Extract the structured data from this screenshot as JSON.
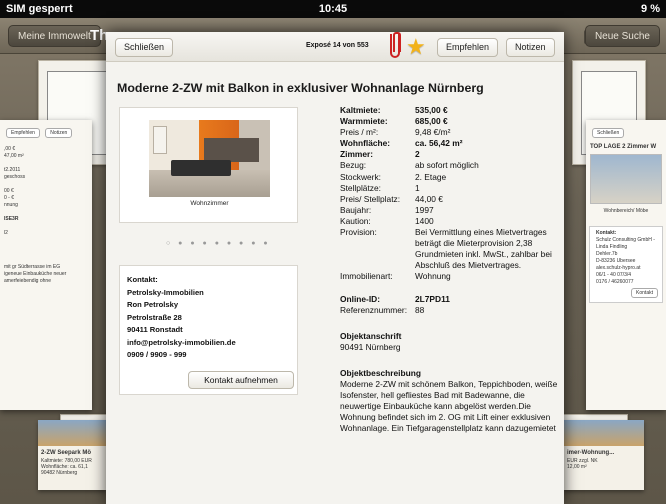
{
  "status_bar": {
    "carrier": "SIM gesperrt",
    "time": "10:45",
    "battery": "9 %"
  },
  "nav": {
    "left_button": "Meine Immowelt",
    "title_fragment": "Th",
    "right_button": "Neue Suche"
  },
  "side_left": {
    "buttons": [
      "Empfehlen",
      "Notizen"
    ],
    "lines": [
      ",00 €",
      "47,00 m²",
      "",
      "t2.2011",
      "geschoss",
      "",
      "00 €",
      "0 - €",
      "nnung",
      "",
      "ISE3R",
      "",
      "l2",
      "",
      "",
      "",
      "mit gr Südterrasse im EG",
      "igeneue Einbauküche neuer",
      "amerfeiebendig ohne"
    ]
  },
  "side_right": {
    "buttons": [
      "Schließen"
    ],
    "title": "TOP LAGE 2 Zimmer W",
    "caption": "Wohnbereich/ Möbe",
    "contact_label": "Kontakt:",
    "lines": [
      "Schulz Consulting GmbH - a",
      "Linda Findling",
      "Dehler.7b",
      "D-83236 Übersee",
      "alex.schulz-hypro.at",
      "06/1 - 40 07/3/4",
      "0176 / 46260077"
    ],
    "button": "Kontakt"
  },
  "bottom_tiles": [
    {
      "title": "2-ZW Seepark Mö",
      "lines": [
        "Kaltmiete: 780,00 EUR",
        "Wohnfläche: ca. 61,1",
        "90482 Nürnberg"
      ]
    },
    {
      "title": "imer-Wohnung...",
      "lines": [
        "EUR zzgl. NK",
        "12,00 m²"
      ]
    }
  ],
  "toolbar": {
    "close_label": "Schließen",
    "expose_counter": "Exposé 14 von 553",
    "recommend_label": "Empfehlen",
    "notes_label": "Notizen"
  },
  "listing": {
    "title": "Moderne 2-ZW mit  Balkon in exklusiver Wohnanlage Nürnberg",
    "photo_caption": "Wohnzimmer",
    "photo_dots": "○ ● ● ● ● ● ● ● ●",
    "contact": {
      "label": "Kontakt:",
      "company": "Petrolsky-Immobilien",
      "name": "Ron Petrolsky",
      "street": "Petrolstraße 28",
      "city": "90411 Ronstadt",
      "email": "info@petrolsky-immobilien.de",
      "phone": "0909 / 9909 - 999",
      "button": "Kontakt aufnehmen"
    },
    "details": [
      {
        "k": "Kaltmiete:",
        "v": "535,00 €",
        "bold": true
      },
      {
        "k": "Warmmiete:",
        "v": "685,00 €",
        "bold": true
      },
      {
        "k": "Preis / m²:",
        "v": "9,48 €/m²",
        "bold": false
      },
      {
        "k": "Wohnfläche:",
        "v": "ca. 56,42 m²",
        "bold": true
      },
      {
        "k": "Zimmer:",
        "v": "2",
        "bold": true
      },
      {
        "k": "Bezug:",
        "v": "ab sofort möglich",
        "bold": false
      },
      {
        "k": "Stockwerk:",
        "v": "2. Etage",
        "bold": false
      },
      {
        "k": "Stellplätze:",
        "v": "1",
        "bold": false
      },
      {
        "k": "Preis/ Stellplatz:",
        "v": "44,00  €",
        "bold": false
      },
      {
        "k": "Baujahr:",
        "v": "1997",
        "bold": false
      },
      {
        "k": "Kaution:",
        "v": "1400",
        "bold": false
      },
      {
        "k": "Provision:",
        "v": "Bei Vermittlung eines Mietvertrages beträgt die Mieterprovision 2,38 Grundmieten inkl. MwSt., zahlbar bei Abschluß des Mietvertrages.",
        "bold": false
      },
      {
        "k": "Immobilienart:",
        "v": "Wohnung",
        "bold": false
      }
    ],
    "online_id_label": "Online-ID:",
    "online_id": "2L7PD11",
    "ref_label": "Referenznummer:",
    "ref": "88",
    "address_heading": "Objektanschrift",
    "address": "90491 Nürnberg",
    "desc_heading": "Objektbeschreibung",
    "description": "Moderne 2-ZW mit schönem Balkon, Teppichboden, weiße Isofenster, hell gefliestes Bad mit Badewanne, die neuwertige Einbauküche kann abgelöst werden.Die Wohnung befindet sich im 2. OG mit Lift einer exklusiven Wohnanlage. Ein Tiefgaragenstellplatz kann dazugemietet"
  }
}
